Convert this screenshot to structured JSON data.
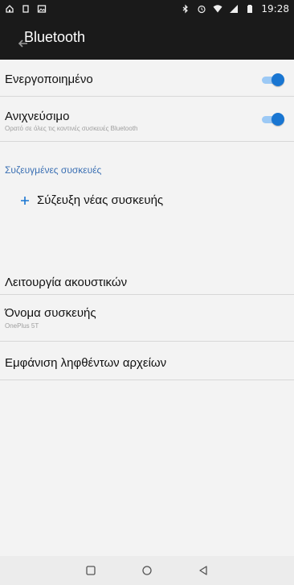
{
  "status_bar": {
    "left_icons": [
      "home-icon",
      "sim-icon",
      "gallery-icon"
    ],
    "right_icons": [
      "bluetooth-icon",
      "alarm-icon",
      "wifi-icon",
      "signal-icon",
      "battery-icon"
    ],
    "time": "19:28"
  },
  "app_bar": {
    "title": "Bluetooth",
    "back_icon": "back-arrow-icon"
  },
  "settings": {
    "enabled": {
      "title": "Ενεργοποιημένο",
      "on": true
    },
    "discoverable": {
      "title": "Ανιχνεύσιμο",
      "subtitle": "Ορατό σε όλες τις κοντινές συσκευές Bluetooth",
      "on": true
    },
    "paired_header": "Συζευγμένες συσκευές",
    "pair_new": {
      "label": "Σύζευξη νέας συσκευής",
      "icon": "plus-icon"
    },
    "headset_mode": {
      "title": "Λειτουργία ακουστικών"
    },
    "device_name": {
      "title": "Όνομα συσκευής",
      "subtitle": "OnePlus 5T"
    },
    "received_files": {
      "title": "Εμφάνιση ληφθέντων αρχείων"
    }
  },
  "nav_bar": {
    "buttons": [
      "recents-icon",
      "home-circle-icon",
      "back-triangle-icon"
    ]
  },
  "colors": {
    "accent": "#1976d2",
    "accent_track": "#9cc9f5",
    "section_header": "#3a6fb3",
    "app_bar": "#1a1a1a",
    "background": "#f3f3f3"
  }
}
